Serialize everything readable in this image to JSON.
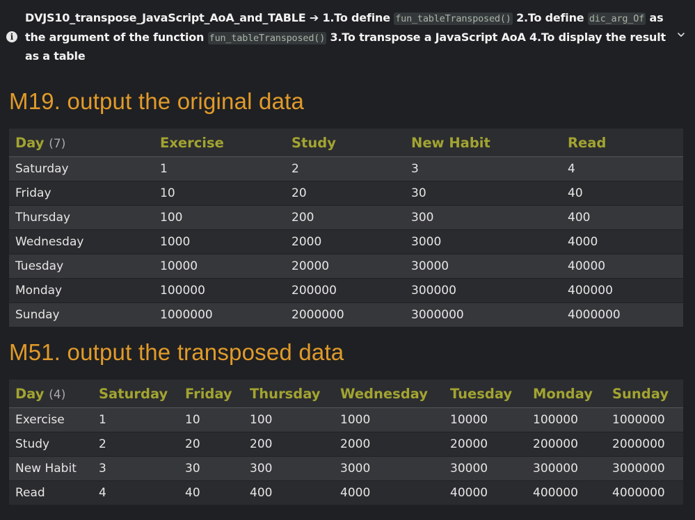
{
  "callout": {
    "icon": "info-icon",
    "title": "DVJS10_transpose_JavaScript_AoA_and_TABLE",
    "arrow": "➔",
    "step1": "1.To define",
    "code1": "fun_tableTransposed()",
    "step2": "2.To define",
    "code2": "dic_arg_Of",
    "step2b": "as the argument of the function",
    "code3": "fun_tableTransposed()",
    "step3": "3.To transpose a JavaScript AoA 4.To display the result as a table",
    "toggle_icon": "chevron-down-icon"
  },
  "section1": {
    "heading": "M19. output the original data",
    "header": {
      "first": "Day",
      "count": "(7)",
      "cols": [
        "Exercise",
        "Study",
        "New Habit",
        "Read"
      ]
    },
    "rows": [
      [
        "Saturday",
        "1",
        "2",
        "3",
        "4"
      ],
      [
        "Friday",
        "10",
        "20",
        "30",
        "40"
      ],
      [
        "Thursday",
        "100",
        "200",
        "300",
        "400"
      ],
      [
        "Wednesday",
        "1000",
        "2000",
        "3000",
        "4000"
      ],
      [
        "Tuesday",
        "10000",
        "20000",
        "30000",
        "40000"
      ],
      [
        "Monday",
        "100000",
        "200000",
        "300000",
        "400000"
      ],
      [
        "Sunday",
        "1000000",
        "2000000",
        "3000000",
        "4000000"
      ]
    ]
  },
  "section2": {
    "heading": "M51. output the transposed data",
    "header": {
      "first": "Day",
      "count": "(4)",
      "cols": [
        "Saturday",
        "Friday",
        "Thursday",
        "Wednesday",
        "Tuesday",
        "Monday",
        "Sunday"
      ]
    },
    "rows": [
      [
        "Exercise",
        "1",
        "10",
        "100",
        "1000",
        "10000",
        "100000",
        "1000000"
      ],
      [
        "Study",
        "2",
        "20",
        "200",
        "2000",
        "20000",
        "200000",
        "2000000"
      ],
      [
        "New Habit",
        "3",
        "30",
        "300",
        "3000",
        "30000",
        "300000",
        "3000000"
      ],
      [
        "Read",
        "4",
        "40",
        "400",
        "4000",
        "40000",
        "400000",
        "4000000"
      ]
    ]
  }
}
